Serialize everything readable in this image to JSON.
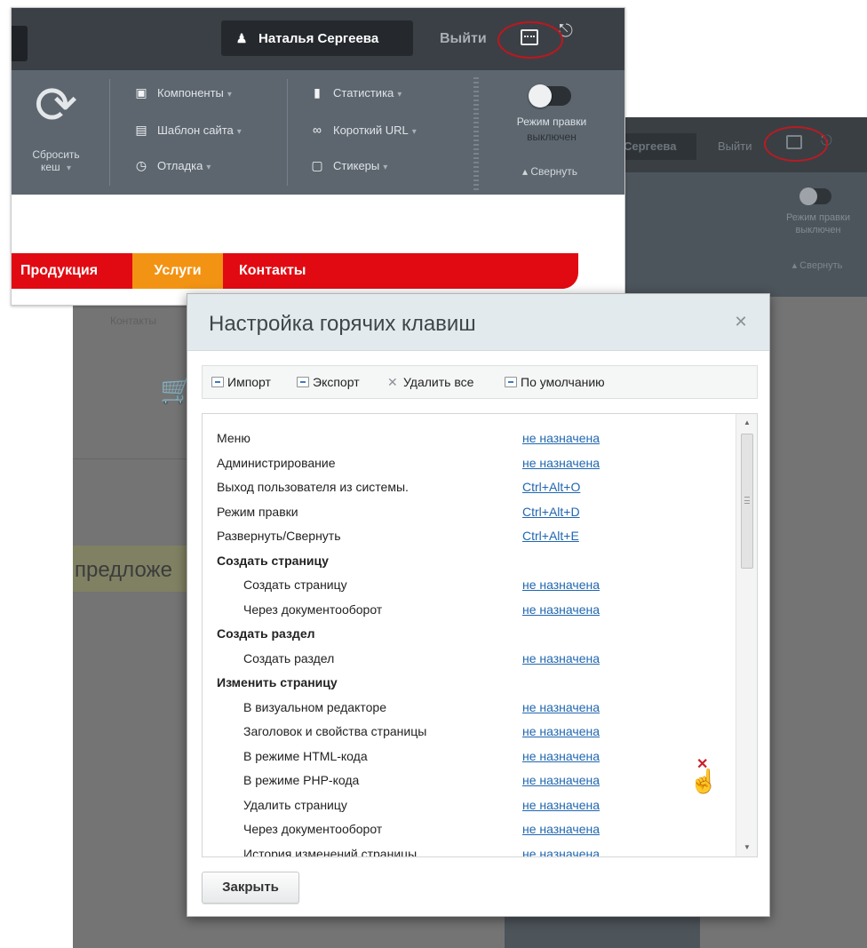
{
  "window": {
    "title": "Настройка горячих клавиш"
  },
  "admin_bar": {
    "user_name": "Наталья Сергеева",
    "logout": "Выйти",
    "reset_cache": {
      "line1": "Сбросить",
      "line2": "кеш"
    },
    "menu_col1": [
      {
        "label": "Компоненты",
        "icon": "components-icon"
      },
      {
        "label": "Шаблон сайта",
        "icon": "template-icon"
      },
      {
        "label": "Отладка",
        "icon": "debug-icon"
      }
    ],
    "menu_col2": [
      {
        "label": "Статистика",
        "icon": "statistics-icon"
      },
      {
        "label": "Короткий URL",
        "icon": "link-icon"
      },
      {
        "label": "Стикеры",
        "icon": "stickers-icon"
      }
    ],
    "edit_mode": {
      "line1": "Режим правки",
      "line2": "выключен"
    },
    "collapse": "Свернуть",
    "highlight_color": "#c0161c"
  },
  "site_menu": {
    "items": [
      {
        "label": "Продукция",
        "active": false
      },
      {
        "label": "Услуги",
        "active": true
      },
      {
        "label": "Контакты",
        "active": false
      }
    ],
    "color": "#e20a12",
    "active_color": "#f39313"
  },
  "background": {
    "user_partial": "Сергеева",
    "logout": "Выйти",
    "edit_mode_line1": "Режим правки",
    "edit_mode_line2": "выключен",
    "collapse": "Свернуть",
    "contacts": "Контакты",
    "offer_partial": "предложе"
  },
  "toolbar": {
    "import": "Импорт",
    "export": "Экспорт",
    "delete_all": "Удалить все",
    "default": "По умолчанию"
  },
  "shortcuts": [
    {
      "label": "Меню",
      "key": "не назначена",
      "type": "item"
    },
    {
      "label": "Администрирование",
      "key": "не назначена",
      "type": "item"
    },
    {
      "label": "Выход пользователя из системы.",
      "key": "Ctrl+Alt+O",
      "type": "item"
    },
    {
      "label": "Режим правки",
      "key": "Ctrl+Alt+D",
      "type": "item"
    },
    {
      "label": "Развернуть/Свернуть",
      "key": "Ctrl+Alt+E",
      "type": "item"
    },
    {
      "label": "Создать страницу",
      "key": "",
      "type": "group"
    },
    {
      "label": "Создать страницу",
      "key": "не назначена",
      "type": "sub"
    },
    {
      "label": "Через документооборот",
      "key": "не назначена",
      "type": "sub"
    },
    {
      "label": "Создать раздел",
      "key": "",
      "type": "group"
    },
    {
      "label": "Создать раздел",
      "key": "не назначена",
      "type": "sub"
    },
    {
      "label": "Изменить страницу",
      "key": "",
      "type": "group"
    },
    {
      "label": "В визуальном редакторе",
      "key": "не назначена",
      "type": "sub"
    },
    {
      "label": "Заголовок и свойства страницы",
      "key": "не назначена",
      "type": "sub"
    },
    {
      "label": "В режиме HTML-кода",
      "key": "не назначена",
      "type": "sub"
    },
    {
      "label": "В режиме PHP-кода",
      "key": "не назначена",
      "type": "sub"
    },
    {
      "label": "Удалить страницу",
      "key": "не назначена",
      "type": "sub"
    },
    {
      "label": "Через документооборот",
      "key": "не назначена",
      "type": "sub"
    },
    {
      "label": "История изменений страницы",
      "key": "не назначена",
      "type": "sub"
    }
  ],
  "footer": {
    "close": "Закрыть"
  },
  "colors": {
    "link": "#2067b0",
    "dialog_header": "#e3eaed"
  }
}
